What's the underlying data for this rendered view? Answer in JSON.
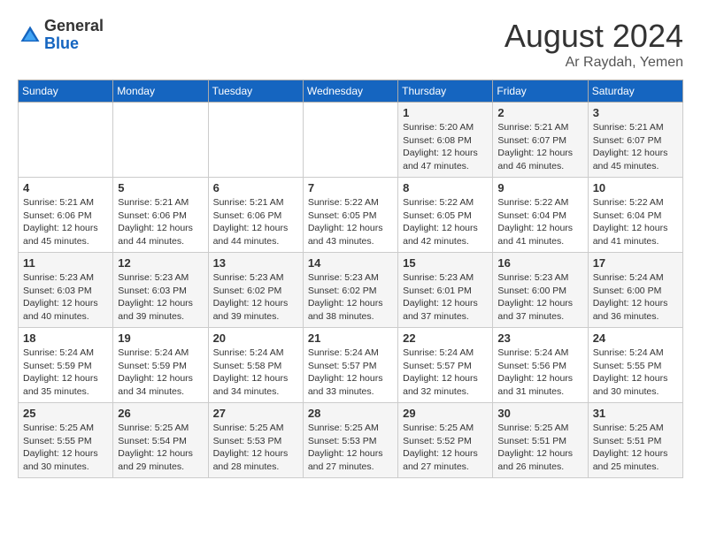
{
  "logo": {
    "general": "General",
    "blue": "Blue"
  },
  "header": {
    "month_year": "August 2024",
    "location": "Ar Raydah, Yemen"
  },
  "days_of_week": [
    "Sunday",
    "Monday",
    "Tuesday",
    "Wednesday",
    "Thursday",
    "Friday",
    "Saturday"
  ],
  "weeks": [
    [
      {
        "day": "",
        "info": ""
      },
      {
        "day": "",
        "info": ""
      },
      {
        "day": "",
        "info": ""
      },
      {
        "day": "",
        "info": ""
      },
      {
        "day": "1",
        "info": "Sunrise: 5:20 AM\nSunset: 6:08 PM\nDaylight: 12 hours\nand 47 minutes."
      },
      {
        "day": "2",
        "info": "Sunrise: 5:21 AM\nSunset: 6:07 PM\nDaylight: 12 hours\nand 46 minutes."
      },
      {
        "day": "3",
        "info": "Sunrise: 5:21 AM\nSunset: 6:07 PM\nDaylight: 12 hours\nand 45 minutes."
      }
    ],
    [
      {
        "day": "4",
        "info": "Sunrise: 5:21 AM\nSunset: 6:06 PM\nDaylight: 12 hours\nand 45 minutes."
      },
      {
        "day": "5",
        "info": "Sunrise: 5:21 AM\nSunset: 6:06 PM\nDaylight: 12 hours\nand 44 minutes."
      },
      {
        "day": "6",
        "info": "Sunrise: 5:21 AM\nSunset: 6:06 PM\nDaylight: 12 hours\nand 44 minutes."
      },
      {
        "day": "7",
        "info": "Sunrise: 5:22 AM\nSunset: 6:05 PM\nDaylight: 12 hours\nand 43 minutes."
      },
      {
        "day": "8",
        "info": "Sunrise: 5:22 AM\nSunset: 6:05 PM\nDaylight: 12 hours\nand 42 minutes."
      },
      {
        "day": "9",
        "info": "Sunrise: 5:22 AM\nSunset: 6:04 PM\nDaylight: 12 hours\nand 41 minutes."
      },
      {
        "day": "10",
        "info": "Sunrise: 5:22 AM\nSunset: 6:04 PM\nDaylight: 12 hours\nand 41 minutes."
      }
    ],
    [
      {
        "day": "11",
        "info": "Sunrise: 5:23 AM\nSunset: 6:03 PM\nDaylight: 12 hours\nand 40 minutes."
      },
      {
        "day": "12",
        "info": "Sunrise: 5:23 AM\nSunset: 6:03 PM\nDaylight: 12 hours\nand 39 minutes."
      },
      {
        "day": "13",
        "info": "Sunrise: 5:23 AM\nSunset: 6:02 PM\nDaylight: 12 hours\nand 39 minutes."
      },
      {
        "day": "14",
        "info": "Sunrise: 5:23 AM\nSunset: 6:02 PM\nDaylight: 12 hours\nand 38 minutes."
      },
      {
        "day": "15",
        "info": "Sunrise: 5:23 AM\nSunset: 6:01 PM\nDaylight: 12 hours\nand 37 minutes."
      },
      {
        "day": "16",
        "info": "Sunrise: 5:23 AM\nSunset: 6:00 PM\nDaylight: 12 hours\nand 37 minutes."
      },
      {
        "day": "17",
        "info": "Sunrise: 5:24 AM\nSunset: 6:00 PM\nDaylight: 12 hours\nand 36 minutes."
      }
    ],
    [
      {
        "day": "18",
        "info": "Sunrise: 5:24 AM\nSunset: 5:59 PM\nDaylight: 12 hours\nand 35 minutes."
      },
      {
        "day": "19",
        "info": "Sunrise: 5:24 AM\nSunset: 5:59 PM\nDaylight: 12 hours\nand 34 minutes."
      },
      {
        "day": "20",
        "info": "Sunrise: 5:24 AM\nSunset: 5:58 PM\nDaylight: 12 hours\nand 34 minutes."
      },
      {
        "day": "21",
        "info": "Sunrise: 5:24 AM\nSunset: 5:57 PM\nDaylight: 12 hours\nand 33 minutes."
      },
      {
        "day": "22",
        "info": "Sunrise: 5:24 AM\nSunset: 5:57 PM\nDaylight: 12 hours\nand 32 minutes."
      },
      {
        "day": "23",
        "info": "Sunrise: 5:24 AM\nSunset: 5:56 PM\nDaylight: 12 hours\nand 31 minutes."
      },
      {
        "day": "24",
        "info": "Sunrise: 5:24 AM\nSunset: 5:55 PM\nDaylight: 12 hours\nand 30 minutes."
      }
    ],
    [
      {
        "day": "25",
        "info": "Sunrise: 5:25 AM\nSunset: 5:55 PM\nDaylight: 12 hours\nand 30 minutes."
      },
      {
        "day": "26",
        "info": "Sunrise: 5:25 AM\nSunset: 5:54 PM\nDaylight: 12 hours\nand 29 minutes."
      },
      {
        "day": "27",
        "info": "Sunrise: 5:25 AM\nSunset: 5:53 PM\nDaylight: 12 hours\nand 28 minutes."
      },
      {
        "day": "28",
        "info": "Sunrise: 5:25 AM\nSunset: 5:53 PM\nDaylight: 12 hours\nand 27 minutes."
      },
      {
        "day": "29",
        "info": "Sunrise: 5:25 AM\nSunset: 5:52 PM\nDaylight: 12 hours\nand 27 minutes."
      },
      {
        "day": "30",
        "info": "Sunrise: 5:25 AM\nSunset: 5:51 PM\nDaylight: 12 hours\nand 26 minutes."
      },
      {
        "day": "31",
        "info": "Sunrise: 5:25 AM\nSunset: 5:51 PM\nDaylight: 12 hours\nand 25 minutes."
      }
    ]
  ]
}
